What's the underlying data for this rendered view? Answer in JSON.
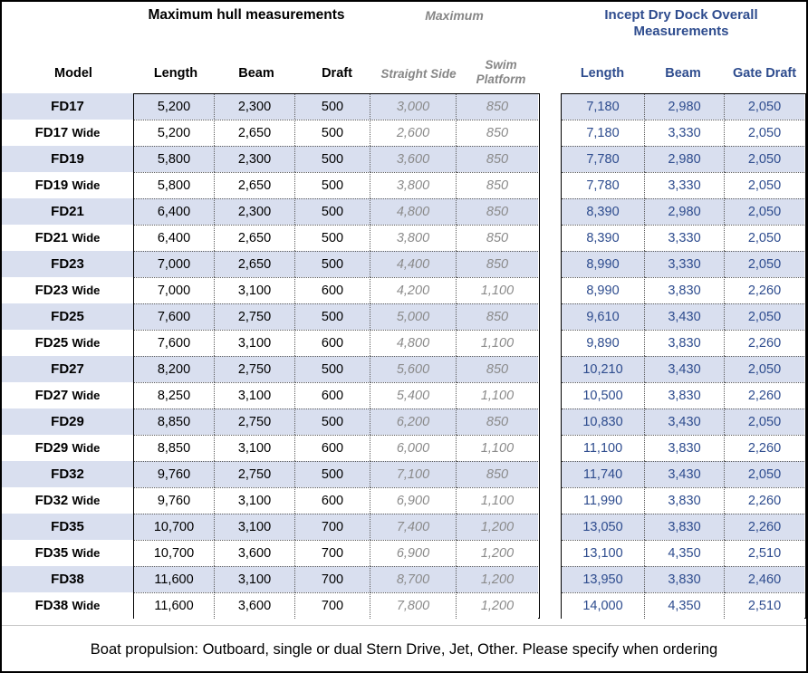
{
  "header": {
    "group_hull": "Maximum hull measurements",
    "group_maximum": "Maximum",
    "group_dock": "Incept Dry Dock Overall Measurements",
    "columns": {
      "model": "Model",
      "hull_length": "Length",
      "hull_beam": "Beam",
      "hull_draft": "Draft",
      "straight_side": "Straight Side",
      "swim_platform": "Swim Platform",
      "dock_length": "Length",
      "dock_beam": "Beam",
      "gate_draft": "Gate Draft"
    }
  },
  "colors": {
    "navy": "#2E4C8E",
    "muted_gray": "#868686",
    "row_band": "#D9DFEF",
    "border": "#000000"
  },
  "rows": [
    {
      "model_base": "FD17",
      "model_suffix": "",
      "hull_length": "5,200",
      "hull_beam": "2,300",
      "hull_draft": "500",
      "straight_side": "3,000",
      "swim_platform": "850",
      "dock_length": "7,180",
      "dock_beam": "2,980",
      "gate_draft": "2,050"
    },
    {
      "model_base": "FD17",
      "model_suffix": "Wide",
      "hull_length": "5,200",
      "hull_beam": "2,650",
      "hull_draft": "500",
      "straight_side": "2,600",
      "swim_platform": "850",
      "dock_length": "7,180",
      "dock_beam": "3,330",
      "gate_draft": "2,050"
    },
    {
      "model_base": "FD19",
      "model_suffix": "",
      "hull_length": "5,800",
      "hull_beam": "2,300",
      "hull_draft": "500",
      "straight_side": "3,600",
      "swim_platform": "850",
      "dock_length": "7,780",
      "dock_beam": "2,980",
      "gate_draft": "2,050"
    },
    {
      "model_base": "FD19",
      "model_suffix": "Wide",
      "hull_length": "5,800",
      "hull_beam": "2,650",
      "hull_draft": "500",
      "straight_side": "3,800",
      "swim_platform": "850",
      "dock_length": "7,780",
      "dock_beam": "3,330",
      "gate_draft": "2,050"
    },
    {
      "model_base": "FD21",
      "model_suffix": "",
      "hull_length": "6,400",
      "hull_beam": "2,300",
      "hull_draft": "500",
      "straight_side": "4,800",
      "swim_platform": "850",
      "dock_length": "8,390",
      "dock_beam": "2,980",
      "gate_draft": "2,050"
    },
    {
      "model_base": "FD21",
      "model_suffix": "Wide",
      "hull_length": "6,400",
      "hull_beam": "2,650",
      "hull_draft": "500",
      "straight_side": "3,800",
      "swim_platform": "850",
      "dock_length": "8,390",
      "dock_beam": "3,330",
      "gate_draft": "2,050"
    },
    {
      "model_base": "FD23",
      "model_suffix": "",
      "hull_length": "7,000",
      "hull_beam": "2,650",
      "hull_draft": "500",
      "straight_side": "4,400",
      "swim_platform": "850",
      "dock_length": "8,990",
      "dock_beam": "3,330",
      "gate_draft": "2,050"
    },
    {
      "model_base": "FD23",
      "model_suffix": "Wide",
      "hull_length": "7,000",
      "hull_beam": "3,100",
      "hull_draft": "600",
      "straight_side": "4,200",
      "swim_platform": "1,100",
      "dock_length": "8,990",
      "dock_beam": "3,830",
      "gate_draft": "2,260"
    },
    {
      "model_base": "FD25",
      "model_suffix": "",
      "hull_length": "7,600",
      "hull_beam": "2,750",
      "hull_draft": "500",
      "straight_side": "5,000",
      "swim_platform": "850",
      "dock_length": "9,610",
      "dock_beam": "3,430",
      "gate_draft": "2,050"
    },
    {
      "model_base": "FD25",
      "model_suffix": "Wide",
      "hull_length": "7,600",
      "hull_beam": "3,100",
      "hull_draft": "600",
      "straight_side": "4,800",
      "swim_platform": "1,100",
      "dock_length": "9,890",
      "dock_beam": "3,830",
      "gate_draft": "2,260"
    },
    {
      "model_base": "FD27",
      "model_suffix": "",
      "hull_length": "8,200",
      "hull_beam": "2,750",
      "hull_draft": "500",
      "straight_side": "5,600",
      "swim_platform": "850",
      "dock_length": "10,210",
      "dock_beam": "3,430",
      "gate_draft": "2,050"
    },
    {
      "model_base": "FD27",
      "model_suffix": "Wide",
      "hull_length": "8,250",
      "hull_beam": "3,100",
      "hull_draft": "600",
      "straight_side": "5,400",
      "swim_platform": "1,100",
      "dock_length": "10,500",
      "dock_beam": "3,830",
      "gate_draft": "2,260"
    },
    {
      "model_base": "FD29",
      "model_suffix": "",
      "hull_length": "8,850",
      "hull_beam": "2,750",
      "hull_draft": "500",
      "straight_side": "6,200",
      "swim_platform": "850",
      "dock_length": "10,830",
      "dock_beam": "3,430",
      "gate_draft": "2,050"
    },
    {
      "model_base": "FD29",
      "model_suffix": "Wide",
      "hull_length": "8,850",
      "hull_beam": "3,100",
      "hull_draft": "600",
      "straight_side": "6,000",
      "swim_platform": "1,100",
      "dock_length": "11,100",
      "dock_beam": "3,830",
      "gate_draft": "2,260"
    },
    {
      "model_base": "FD32",
      "model_suffix": "",
      "hull_length": "9,760",
      "hull_beam": "2,750",
      "hull_draft": "500",
      "straight_side": "7,100",
      "swim_platform": "850",
      "dock_length": "11,740",
      "dock_beam": "3,430",
      "gate_draft": "2,050"
    },
    {
      "model_base": "FD32",
      "model_suffix": "Wide",
      "hull_length": "9,760",
      "hull_beam": "3,100",
      "hull_draft": "600",
      "straight_side": "6,900",
      "swim_platform": "1,100",
      "dock_length": "11,990",
      "dock_beam": "3,830",
      "gate_draft": "2,260"
    },
    {
      "model_base": "FD35",
      "model_suffix": "",
      "hull_length": "10,700",
      "hull_beam": "3,100",
      "hull_draft": "700",
      "straight_side": "7,400",
      "swim_platform": "1,200",
      "dock_length": "13,050",
      "dock_beam": "3,830",
      "gate_draft": "2,260"
    },
    {
      "model_base": "FD35",
      "model_suffix": "Wide",
      "hull_length": "10,700",
      "hull_beam": "3,600",
      "hull_draft": "700",
      "straight_side": "6,900",
      "swim_platform": "1,200",
      "dock_length": "13,100",
      "dock_beam": "4,350",
      "gate_draft": "2,510"
    },
    {
      "model_base": "FD38",
      "model_suffix": "",
      "hull_length": "11,600",
      "hull_beam": "3,100",
      "hull_draft": "700",
      "straight_side": "8,700",
      "swim_platform": "1,200",
      "dock_length": "13,950",
      "dock_beam": "3,830",
      "gate_draft": "2,460"
    },
    {
      "model_base": "FD38",
      "model_suffix": "Wide",
      "hull_length": "11,600",
      "hull_beam": "3,600",
      "hull_draft": "700",
      "straight_side": "7,800",
      "swim_platform": "1,200",
      "dock_length": "14,000",
      "dock_beam": "4,350",
      "gate_draft": "2,510"
    }
  ],
  "footer": {
    "note": "Boat propulsion: Outboard, single or dual Stern Drive, Jet, Other. Please specify when ordering"
  }
}
